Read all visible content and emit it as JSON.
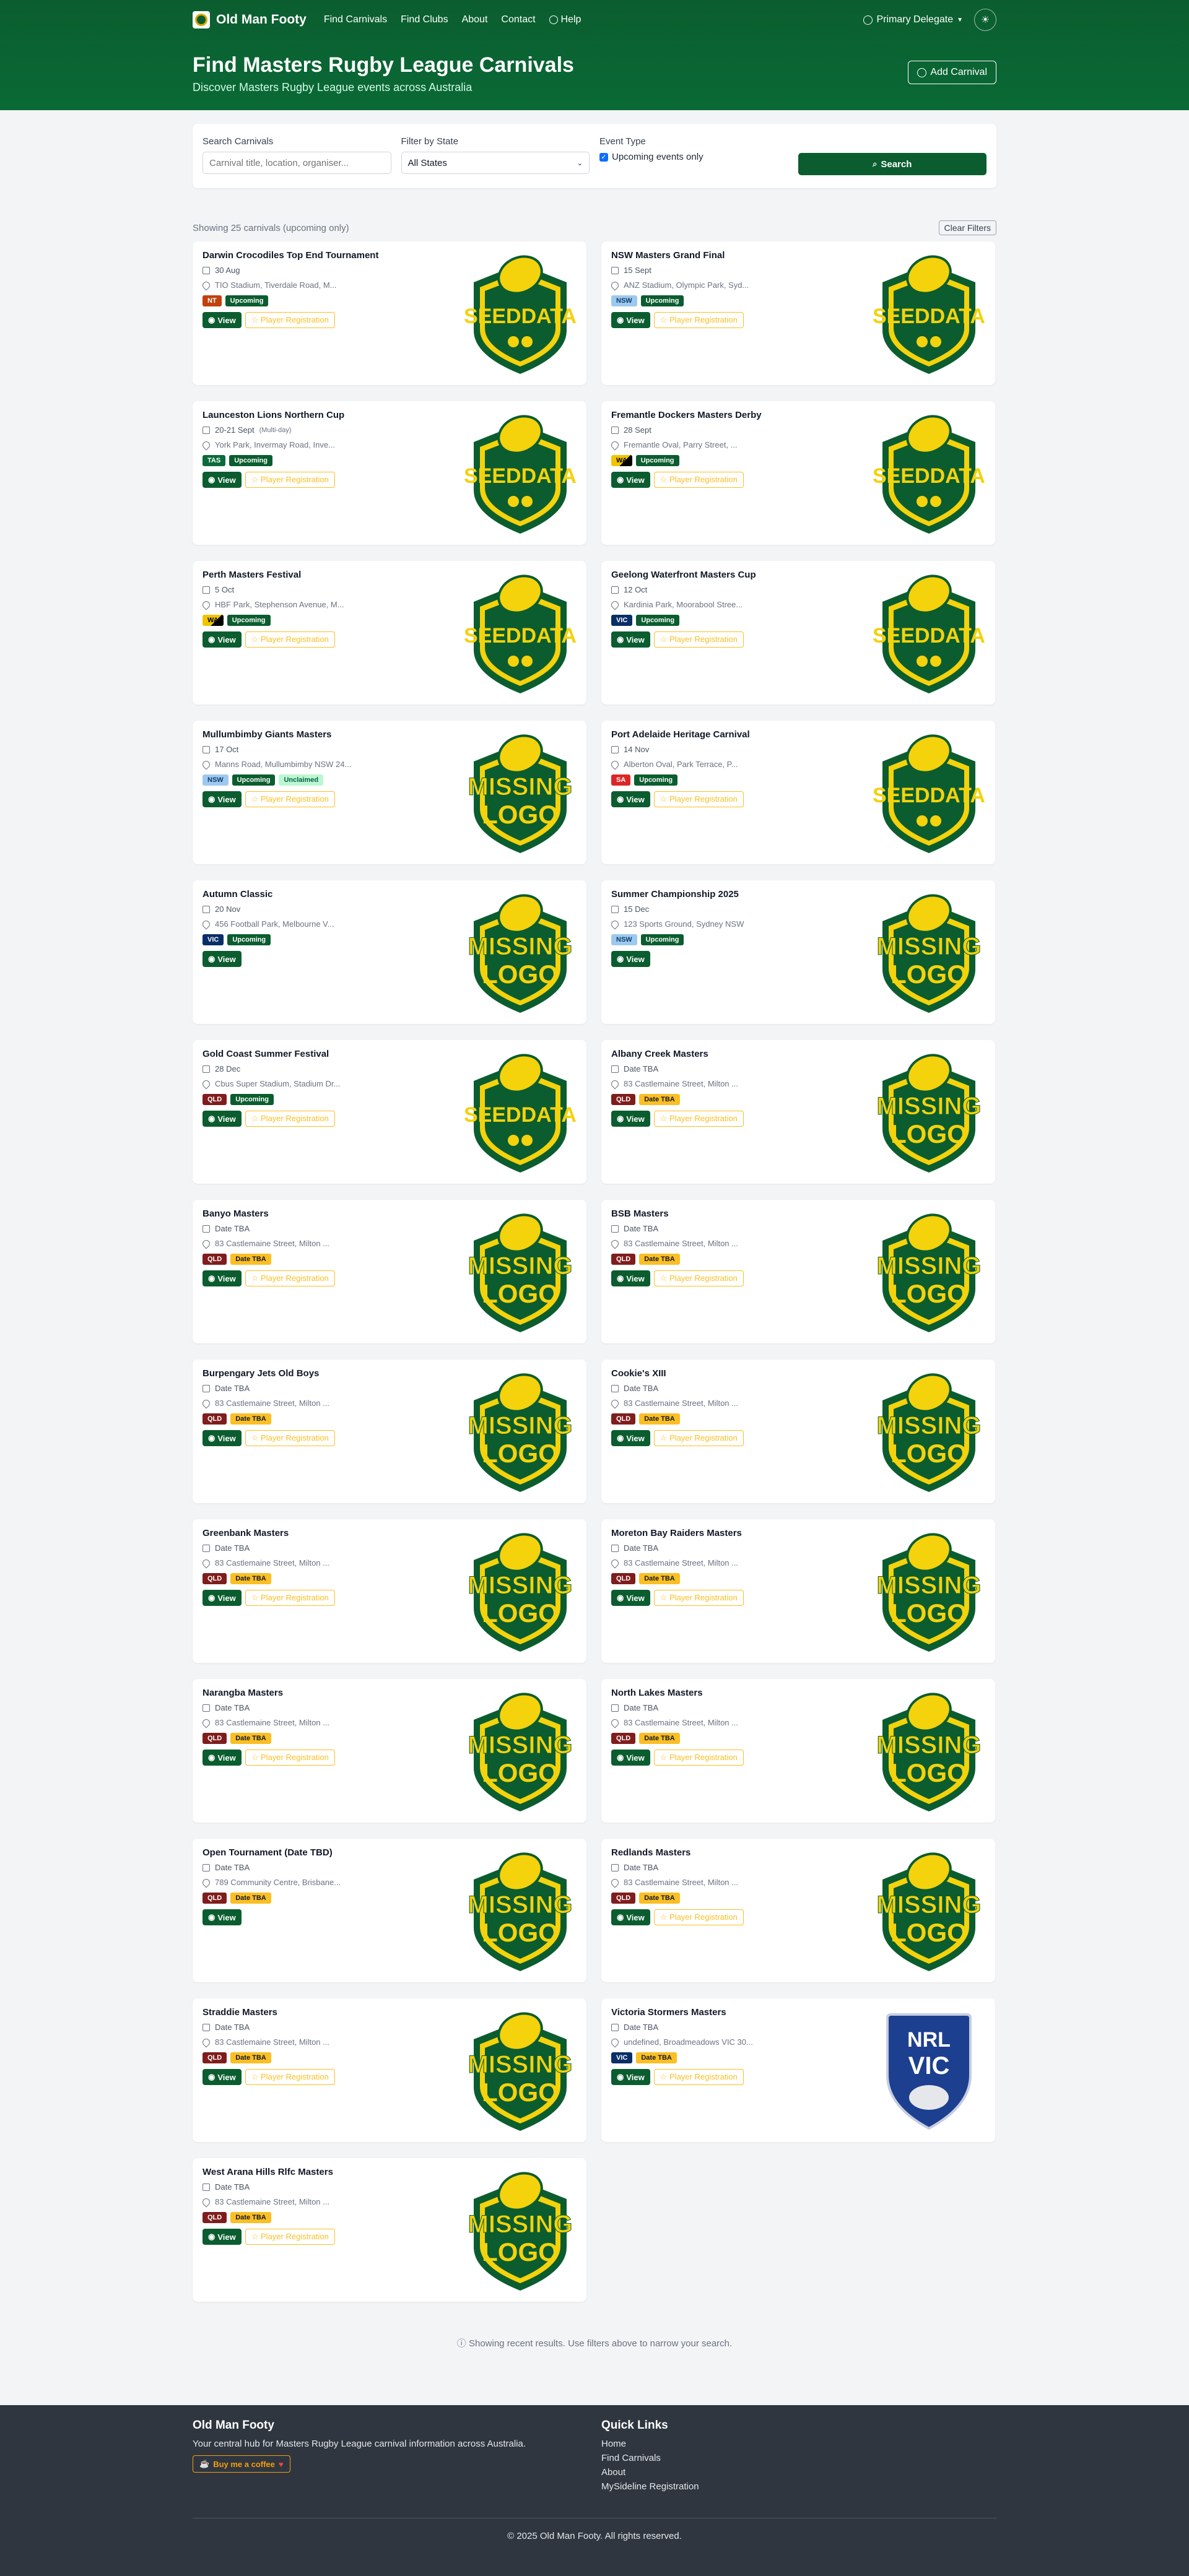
{
  "nav": {
    "brand": "Old Man Footy",
    "links": [
      "Find Carnivals",
      "Find Clubs",
      "About",
      "Contact",
      "Help"
    ],
    "user": "Primary Delegate",
    "theme_icon": "☀"
  },
  "header": {
    "title": "Find Masters Rugby League Carnivals",
    "subtitle": "Discover Masters Rugby League events across Australia",
    "add_button": "Add Carnival"
  },
  "filters": {
    "search_label": "Search Carnivals",
    "search_placeholder": "Carnival title, location, organiser...",
    "state_label": "Filter by State",
    "state_value": "All States",
    "event_label": "Event Type",
    "upcoming_label": "Upcoming events only",
    "search_button": "Search"
  },
  "results": {
    "summary": "Showing 25 carnivals (upcoming only)",
    "clear_button": "Clear Filters"
  },
  "cards": [
    {
      "title": "Darwin Crocodiles Top End Tournament",
      "date": "30 Aug",
      "note": "",
      "location": "TIO Stadium, Tiverdale Road, M...",
      "state": "NT",
      "status": "Upcoming",
      "extra": "",
      "register": true,
      "logo": "seeddata"
    },
    {
      "title": "NSW Masters Grand Final",
      "date": "15 Sept",
      "note": "",
      "location": "ANZ Stadium, Olympic Park, Syd...",
      "state": "NSW",
      "status": "Upcoming",
      "extra": "",
      "register": true,
      "logo": "seeddata"
    },
    {
      "title": "Launceston Lions Northern Cup",
      "date": "20-21 Sept",
      "note": "(Multi-day)",
      "location": "York Park, Invermay Road, Inve...",
      "state": "TAS",
      "status": "Upcoming",
      "extra": "",
      "register": true,
      "logo": "seeddata"
    },
    {
      "title": "Fremantle Dockers Masters Derby",
      "date": "28 Sept",
      "note": "",
      "location": "Fremantle Oval, Parry Street, ...",
      "state": "WA",
      "status": "Upcoming",
      "extra": "",
      "register": true,
      "logo": "seeddata"
    },
    {
      "title": "Perth Masters Festival",
      "date": "5 Oct",
      "note": "",
      "location": "HBF Park, Stephenson Avenue, M...",
      "state": "WA",
      "status": "Upcoming",
      "extra": "",
      "register": true,
      "logo": "seeddata"
    },
    {
      "title": "Geelong Waterfront Masters Cup",
      "date": "12 Oct",
      "note": "",
      "location": "Kardinia Park, Moorabool Stree...",
      "state": "VIC",
      "status": "Upcoming",
      "extra": "",
      "register": true,
      "logo": "seeddata"
    },
    {
      "title": "Mullumbimby Giants Masters",
      "date": "17 Oct",
      "note": "",
      "location": "Manns Road, Mullumbimby NSW 24...",
      "state": "NSW",
      "status": "Upcoming",
      "extra": "Unclaimed",
      "register": true,
      "logo": "missing"
    },
    {
      "title": "Port Adelaide Heritage Carnival",
      "date": "14 Nov",
      "note": "",
      "location": "Alberton Oval, Park Terrace, P...",
      "state": "SA",
      "status": "Upcoming",
      "extra": "",
      "register": true,
      "logo": "seeddata"
    },
    {
      "title": "Autumn Classic",
      "date": "20 Nov",
      "note": "",
      "location": "456 Football Park, Melbourne V...",
      "state": "VIC",
      "status": "Upcoming",
      "extra": "",
      "register": false,
      "logo": "missing"
    },
    {
      "title": "Summer Championship 2025",
      "date": "15 Dec",
      "note": "",
      "location": "123 Sports Ground, Sydney NSW",
      "state": "NSW",
      "status": "Upcoming",
      "extra": "",
      "register": false,
      "logo": "missing"
    },
    {
      "title": "Gold Coast Summer Festival",
      "date": "28 Dec",
      "note": "",
      "location": "Cbus Super Stadium, Stadium Dr...",
      "state": "QLD",
      "status": "Upcoming",
      "extra": "",
      "register": true,
      "logo": "seeddata"
    },
    {
      "title": "Albany Creek Masters",
      "date": "Date TBA",
      "note": "",
      "location": "83 Castlemaine Street, Milton ...",
      "state": "QLD",
      "status": "Date TBA",
      "extra": "",
      "register": true,
      "logo": "missing"
    },
    {
      "title": "Banyo Masters",
      "date": "Date TBA",
      "note": "",
      "location": "83 Castlemaine Street, Milton ...",
      "state": "QLD",
      "status": "Date TBA",
      "extra": "",
      "register": true,
      "logo": "missing"
    },
    {
      "title": "BSB Masters",
      "date": "Date TBA",
      "note": "",
      "location": "83 Castlemaine Street, Milton ...",
      "state": "QLD",
      "status": "Date TBA",
      "extra": "",
      "register": true,
      "logo": "missing"
    },
    {
      "title": "Burpengary Jets Old Boys",
      "date": "Date TBA",
      "note": "",
      "location": "83 Castlemaine Street, Milton ...",
      "state": "QLD",
      "status": "Date TBA",
      "extra": "",
      "register": true,
      "logo": "missing"
    },
    {
      "title": "Cookie's XIII",
      "date": "Date TBA",
      "note": "",
      "location": "83 Castlemaine Street, Milton ...",
      "state": "QLD",
      "status": "Date TBA",
      "extra": "",
      "register": true,
      "logo": "missing"
    },
    {
      "title": "Greenbank Masters",
      "date": "Date TBA",
      "note": "",
      "location": "83 Castlemaine Street, Milton ...",
      "state": "QLD",
      "status": "Date TBA",
      "extra": "",
      "register": true,
      "logo": "missing"
    },
    {
      "title": "Moreton Bay Raiders Masters",
      "date": "Date TBA",
      "note": "",
      "location": "83 Castlemaine Street, Milton ...",
      "state": "QLD",
      "status": "Date TBA",
      "extra": "",
      "register": true,
      "logo": "missing"
    },
    {
      "title": "Narangba Masters",
      "date": "Date TBA",
      "note": "",
      "location": "83 Castlemaine Street, Milton ...",
      "state": "QLD",
      "status": "Date TBA",
      "extra": "",
      "register": true,
      "logo": "missing"
    },
    {
      "title": "North Lakes Masters",
      "date": "Date TBA",
      "note": "",
      "location": "83 Castlemaine Street, Milton ...",
      "state": "QLD",
      "status": "Date TBA",
      "extra": "",
      "register": true,
      "logo": "missing"
    },
    {
      "title": "Open Tournament (Date TBD)",
      "date": "Date TBA",
      "note": "",
      "location": "789 Community Centre, Brisbane...",
      "state": "QLD",
      "status": "Date TBA",
      "extra": "",
      "register": false,
      "logo": "missing"
    },
    {
      "title": "Redlands Masters",
      "date": "Date TBA",
      "note": "",
      "location": "83 Castlemaine Street, Milton ...",
      "state": "QLD",
      "status": "Date TBA",
      "extra": "",
      "register": true,
      "logo": "missing"
    },
    {
      "title": "Straddie Masters",
      "date": "Date TBA",
      "note": "",
      "location": "83 Castlemaine Street, Milton ...",
      "state": "QLD",
      "status": "Date TBA",
      "extra": "",
      "register": true,
      "logo": "missing"
    },
    {
      "title": "Victoria Stormers Masters",
      "date": "Date TBA",
      "note": "",
      "location": "undefined, Broadmeadows VIC 30...",
      "state": "VIC",
      "status": "Date TBA",
      "extra": "",
      "register": true,
      "logo": "nrlvic"
    },
    {
      "title": "West Arana Hills Rlfc Masters",
      "date": "Date TBA",
      "note": "",
      "location": "83 Castlemaine Street, Milton ...",
      "state": "QLD",
      "status": "Date TBA",
      "extra": "",
      "register": true,
      "logo": "missing"
    }
  ],
  "card_labels": {
    "view": "View",
    "register": "Player Registration",
    "logo_seed_top": "SEED",
    "logo_seed_bottom": "DATA",
    "logo_missing_top": "MISSING",
    "logo_missing_bottom": "LOGO",
    "logo_nrl_top": "NRL",
    "logo_nrl_bottom": "VIC"
  },
  "results_note": "Showing recent results. Use filters above to narrow your search.",
  "footer": {
    "title": "Old Man Footy",
    "tagline": "Your central hub for Masters Rugby League carnival information across Australia.",
    "coffee": "Buy me a coffee",
    "quick_links_title": "Quick Links",
    "quick_links": [
      "Home",
      "Find Carnivals",
      "About",
      "MySideline Registration"
    ],
    "copyright": "© 2025 Old Man Footy. All rights reserved."
  },
  "colors": {
    "primary": "#0b5d2f",
    "accent": "#fbbf24",
    "footer_bg": "#2f3640"
  }
}
